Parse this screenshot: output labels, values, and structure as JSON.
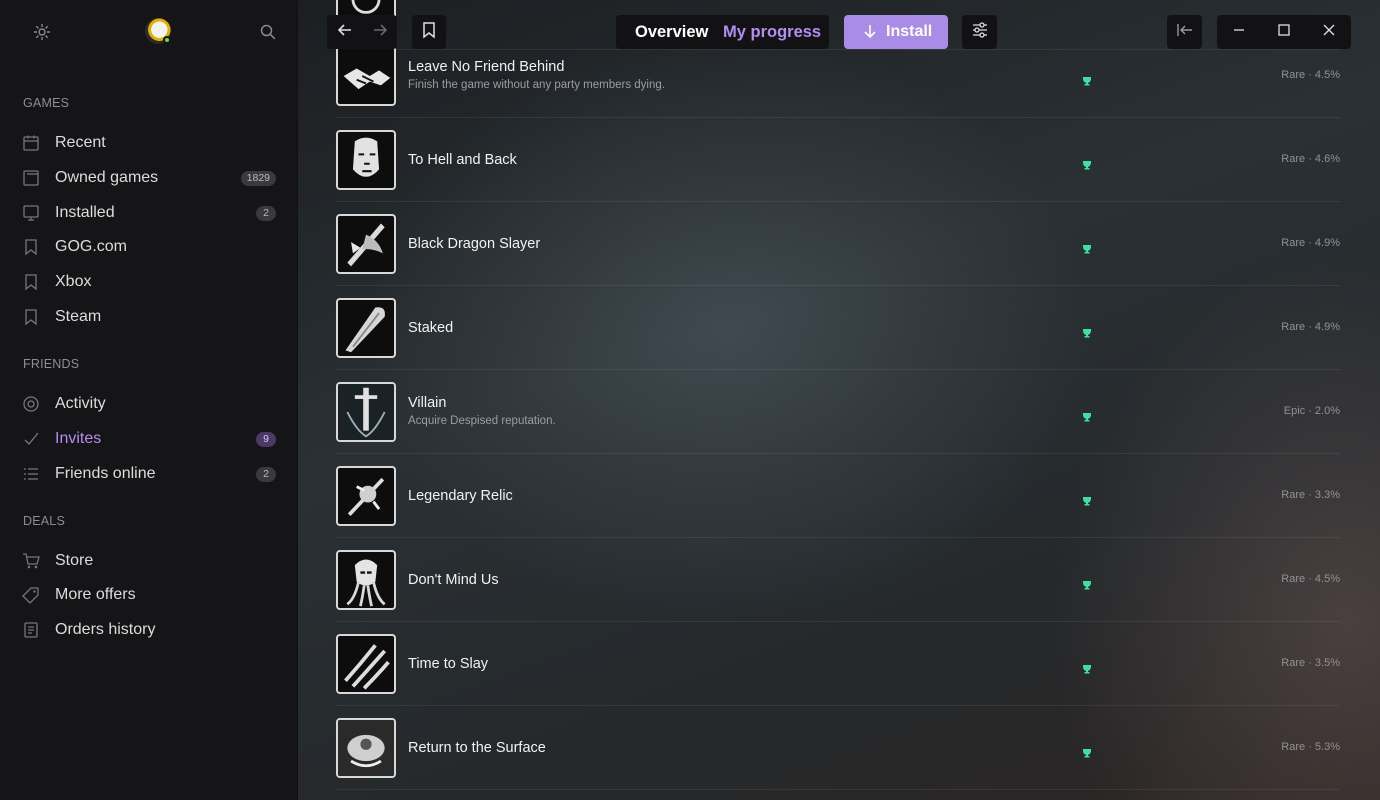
{
  "sidebar": {
    "sections": {
      "games": "GAMES",
      "friends": "FRIENDS",
      "deals": "DEALS"
    },
    "games": [
      {
        "label": "Recent",
        "icon": "calendar-icon",
        "badge": ""
      },
      {
        "label": "Owned games",
        "icon": "window-icon",
        "badge": "1829"
      },
      {
        "label": "Installed",
        "icon": "monitor-icon",
        "badge": "2"
      },
      {
        "label": "GOG.com",
        "icon": "bookmark-icon",
        "badge": ""
      },
      {
        "label": "Xbox",
        "icon": "bookmark-icon",
        "badge": ""
      },
      {
        "label": "Steam",
        "icon": "bookmark-icon",
        "badge": ""
      }
    ],
    "friends": [
      {
        "label": "Activity",
        "icon": "target-icon",
        "badge": ""
      },
      {
        "label": "Invites",
        "icon": "check-icon",
        "badge": "9"
      },
      {
        "label": "Friends online",
        "icon": "list-icon",
        "badge": "2"
      }
    ],
    "deals": [
      {
        "label": "Store",
        "icon": "cart-icon",
        "badge": ""
      },
      {
        "label": "More offers",
        "icon": "tag-icon",
        "badge": ""
      },
      {
        "label": "Orders history",
        "icon": "receipt-icon",
        "badge": ""
      }
    ]
  },
  "topbar": {
    "tab_overview": "Overview",
    "tab_progress": "My progress",
    "install_label": "Install"
  },
  "achievements": [
    {
      "name": "Leave No Friend Behind",
      "description": "Finish the game without any party members dying.",
      "rarity": "Rare · 4.5%",
      "icon": "handshake-icon"
    },
    {
      "name": "To Hell and Back",
      "description": "",
      "rarity": "Rare · 4.6%",
      "icon": "face-icon"
    },
    {
      "name": "Black Dragon Slayer",
      "description": "",
      "rarity": "Rare · 4.9%",
      "icon": "dragon-icon"
    },
    {
      "name": "Staked",
      "description": "",
      "rarity": "Rare · 4.9%",
      "icon": "stake-icon"
    },
    {
      "name": "Villain",
      "description": "Acquire Despised reputation.",
      "rarity": "Epic · 2.0%",
      "icon": "sword-icon"
    },
    {
      "name": "Legendary Relic",
      "description": "",
      "rarity": "Rare · 3.3%",
      "icon": "relic-icon"
    },
    {
      "name": "Don't Mind Us",
      "description": "",
      "rarity": "Rare · 4.5%",
      "icon": "mindflayer-icon"
    },
    {
      "name": "Time to Slay",
      "description": "",
      "rarity": "Rare · 3.5%",
      "icon": "claw-icon"
    },
    {
      "name": "Return to the Surface",
      "description": "",
      "rarity": "Rare · 5.3%",
      "icon": "surface-icon"
    }
  ],
  "colors": {
    "accent": "#a98ce6",
    "active_nav": "#b48cf2",
    "trophy": "#3ee0a0"
  }
}
